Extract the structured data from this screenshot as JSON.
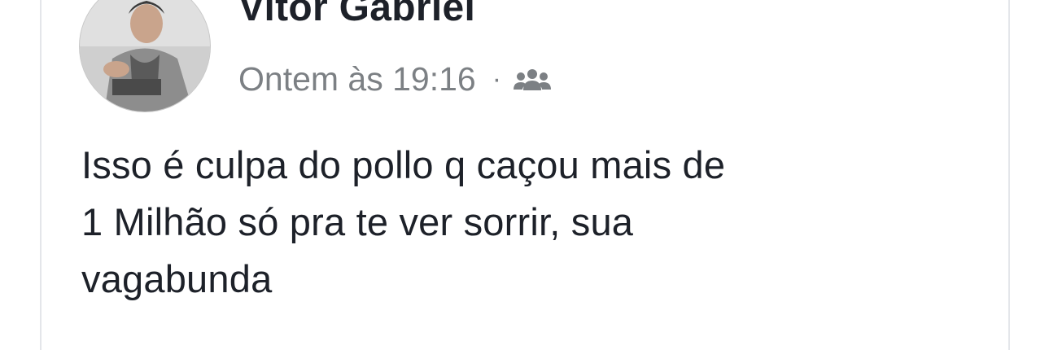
{
  "post": {
    "author_name": "Vitor Gabriel",
    "timestamp": "Ontem às 19:16",
    "separator": "·",
    "audience_icon": "friends-audience-icon",
    "text_lines": [
      "Isso é culpa do pollo q caçou mais de",
      "1 Milhão só pra te ver sorrir, sua",
      "vagabunda"
    ]
  }
}
